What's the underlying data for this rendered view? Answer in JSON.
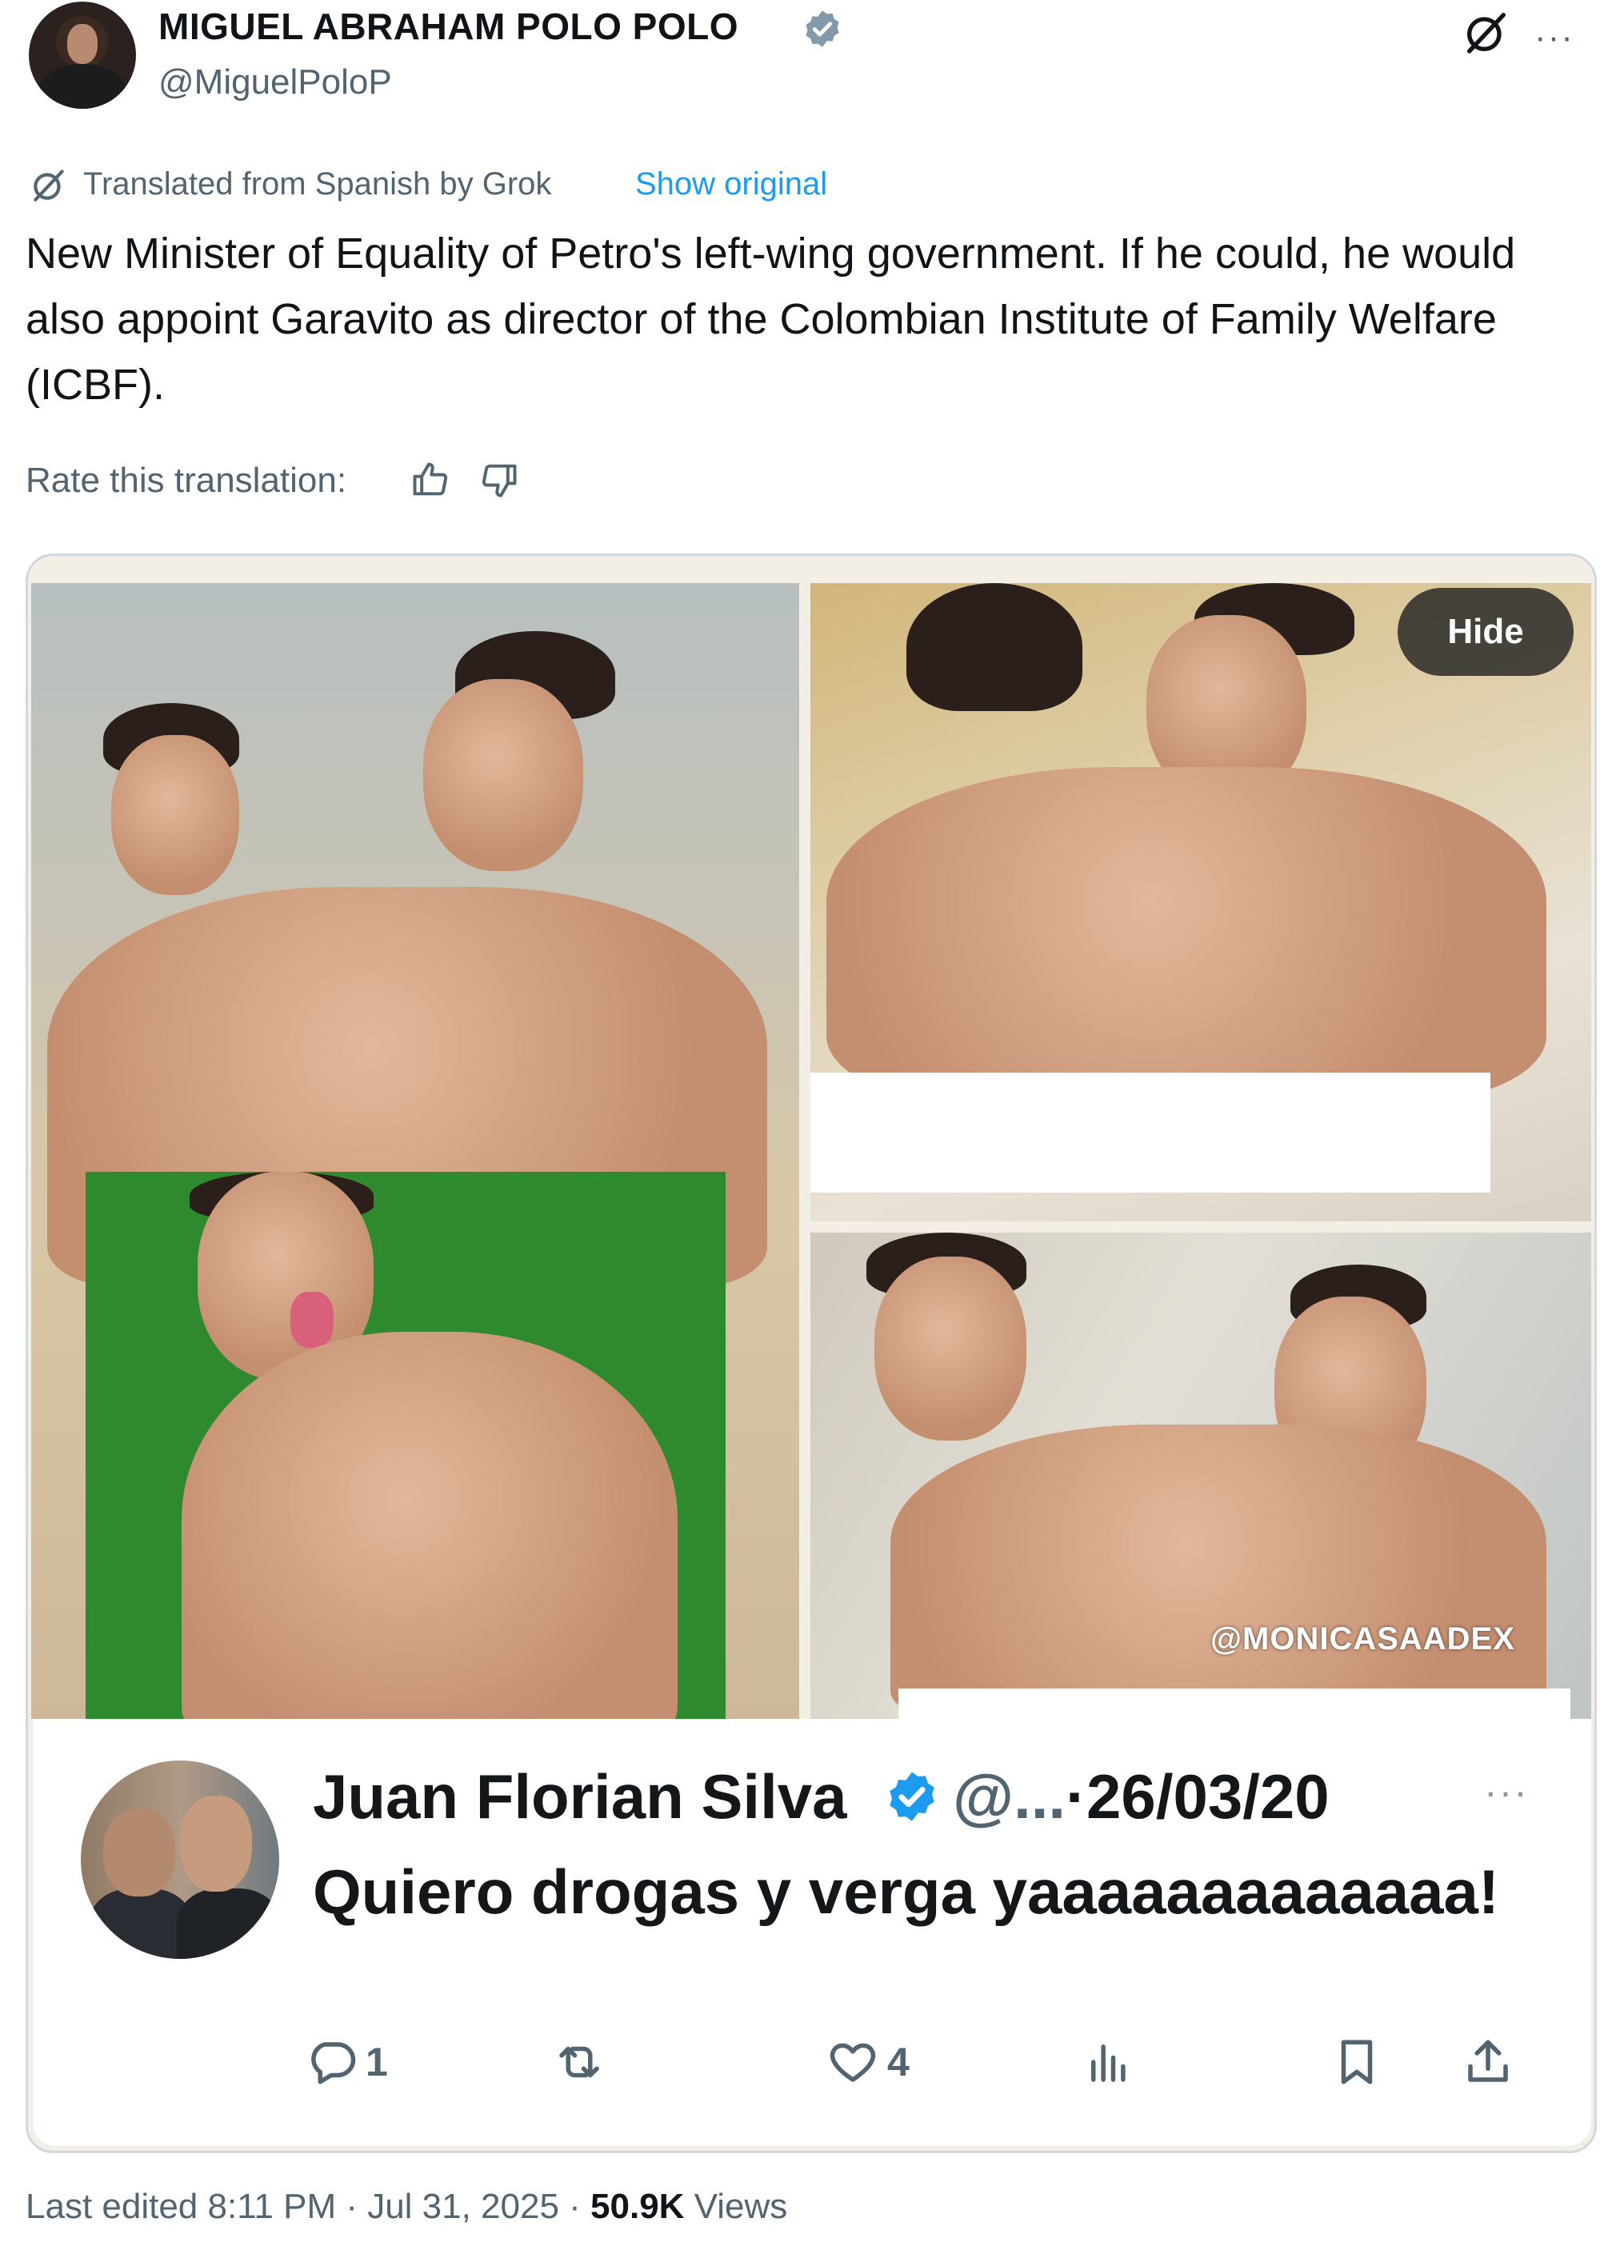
{
  "header": {
    "author_name": "MIGUEL ABRAHAM POLO POLO",
    "author_handle": "@MiguelPoloP",
    "more_label": "···"
  },
  "translation": {
    "note": "Translated from Spanish by Grok",
    "show_original": "Show original",
    "rate_label": "Rate this translation:"
  },
  "tweet": {
    "text": "New Minister of Equality of Petro's left-wing government. If he could, he would also appoint Garavito as director of the Colombian Institute of Family Welfare (ICBF)."
  },
  "media": {
    "hide_label": "Hide",
    "watermark": "@MONICASAADEX"
  },
  "quoted": {
    "name": "Juan Florian Silva",
    "handle": "@...",
    "date": "·26/03/20",
    "more_label": "···",
    "text": "Quiero drogas y verga yaaaaaaaaaaaaa!",
    "reply_count": "1",
    "like_count": "4"
  },
  "footer": {
    "edited": "Last edited 8:11 PM · Jul 31, 2025 · ",
    "views_count": "50.9K",
    "views_label": " Views"
  },
  "colors": {
    "accent": "#1d9bf0",
    "secondary_text": "#536471",
    "verified": "#1d9bf0"
  }
}
